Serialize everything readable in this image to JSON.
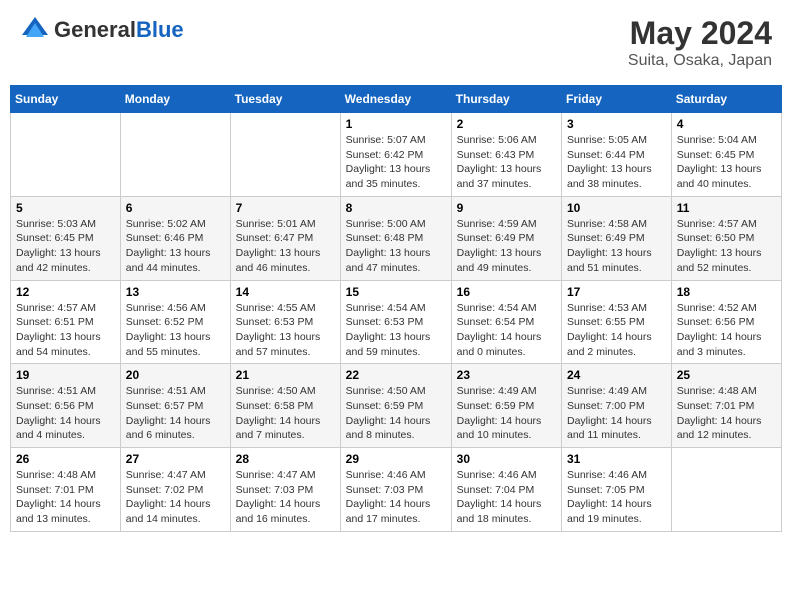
{
  "header": {
    "logo_general": "General",
    "logo_blue": "Blue",
    "month": "May 2024",
    "location": "Suita, Osaka, Japan"
  },
  "days_of_week": [
    "Sunday",
    "Monday",
    "Tuesday",
    "Wednesday",
    "Thursday",
    "Friday",
    "Saturday"
  ],
  "weeks": [
    [
      {
        "day": "",
        "info": ""
      },
      {
        "day": "",
        "info": ""
      },
      {
        "day": "",
        "info": ""
      },
      {
        "day": "1",
        "info": "Sunrise: 5:07 AM\nSunset: 6:42 PM\nDaylight: 13 hours\nand 35 minutes."
      },
      {
        "day": "2",
        "info": "Sunrise: 5:06 AM\nSunset: 6:43 PM\nDaylight: 13 hours\nand 37 minutes."
      },
      {
        "day": "3",
        "info": "Sunrise: 5:05 AM\nSunset: 6:44 PM\nDaylight: 13 hours\nand 38 minutes."
      },
      {
        "day": "4",
        "info": "Sunrise: 5:04 AM\nSunset: 6:45 PM\nDaylight: 13 hours\nand 40 minutes."
      }
    ],
    [
      {
        "day": "5",
        "info": "Sunrise: 5:03 AM\nSunset: 6:45 PM\nDaylight: 13 hours\nand 42 minutes."
      },
      {
        "day": "6",
        "info": "Sunrise: 5:02 AM\nSunset: 6:46 PM\nDaylight: 13 hours\nand 44 minutes."
      },
      {
        "day": "7",
        "info": "Sunrise: 5:01 AM\nSunset: 6:47 PM\nDaylight: 13 hours\nand 46 minutes."
      },
      {
        "day": "8",
        "info": "Sunrise: 5:00 AM\nSunset: 6:48 PM\nDaylight: 13 hours\nand 47 minutes."
      },
      {
        "day": "9",
        "info": "Sunrise: 4:59 AM\nSunset: 6:49 PM\nDaylight: 13 hours\nand 49 minutes."
      },
      {
        "day": "10",
        "info": "Sunrise: 4:58 AM\nSunset: 6:49 PM\nDaylight: 13 hours\nand 51 minutes."
      },
      {
        "day": "11",
        "info": "Sunrise: 4:57 AM\nSunset: 6:50 PM\nDaylight: 13 hours\nand 52 minutes."
      }
    ],
    [
      {
        "day": "12",
        "info": "Sunrise: 4:57 AM\nSunset: 6:51 PM\nDaylight: 13 hours\nand 54 minutes."
      },
      {
        "day": "13",
        "info": "Sunrise: 4:56 AM\nSunset: 6:52 PM\nDaylight: 13 hours\nand 55 minutes."
      },
      {
        "day": "14",
        "info": "Sunrise: 4:55 AM\nSunset: 6:53 PM\nDaylight: 13 hours\nand 57 minutes."
      },
      {
        "day": "15",
        "info": "Sunrise: 4:54 AM\nSunset: 6:53 PM\nDaylight: 13 hours\nand 59 minutes."
      },
      {
        "day": "16",
        "info": "Sunrise: 4:54 AM\nSunset: 6:54 PM\nDaylight: 14 hours\nand 0 minutes."
      },
      {
        "day": "17",
        "info": "Sunrise: 4:53 AM\nSunset: 6:55 PM\nDaylight: 14 hours\nand 2 minutes."
      },
      {
        "day": "18",
        "info": "Sunrise: 4:52 AM\nSunset: 6:56 PM\nDaylight: 14 hours\nand 3 minutes."
      }
    ],
    [
      {
        "day": "19",
        "info": "Sunrise: 4:51 AM\nSunset: 6:56 PM\nDaylight: 14 hours\nand 4 minutes."
      },
      {
        "day": "20",
        "info": "Sunrise: 4:51 AM\nSunset: 6:57 PM\nDaylight: 14 hours\nand 6 minutes."
      },
      {
        "day": "21",
        "info": "Sunrise: 4:50 AM\nSunset: 6:58 PM\nDaylight: 14 hours\nand 7 minutes."
      },
      {
        "day": "22",
        "info": "Sunrise: 4:50 AM\nSunset: 6:59 PM\nDaylight: 14 hours\nand 8 minutes."
      },
      {
        "day": "23",
        "info": "Sunrise: 4:49 AM\nSunset: 6:59 PM\nDaylight: 14 hours\nand 10 minutes."
      },
      {
        "day": "24",
        "info": "Sunrise: 4:49 AM\nSunset: 7:00 PM\nDaylight: 14 hours\nand 11 minutes."
      },
      {
        "day": "25",
        "info": "Sunrise: 4:48 AM\nSunset: 7:01 PM\nDaylight: 14 hours\nand 12 minutes."
      }
    ],
    [
      {
        "day": "26",
        "info": "Sunrise: 4:48 AM\nSunset: 7:01 PM\nDaylight: 14 hours\nand 13 minutes."
      },
      {
        "day": "27",
        "info": "Sunrise: 4:47 AM\nSunset: 7:02 PM\nDaylight: 14 hours\nand 14 minutes."
      },
      {
        "day": "28",
        "info": "Sunrise: 4:47 AM\nSunset: 7:03 PM\nDaylight: 14 hours\nand 16 minutes."
      },
      {
        "day": "29",
        "info": "Sunrise: 4:46 AM\nSunset: 7:03 PM\nDaylight: 14 hours\nand 17 minutes."
      },
      {
        "day": "30",
        "info": "Sunrise: 4:46 AM\nSunset: 7:04 PM\nDaylight: 14 hours\nand 18 minutes."
      },
      {
        "day": "31",
        "info": "Sunrise: 4:46 AM\nSunset: 7:05 PM\nDaylight: 14 hours\nand 19 minutes."
      },
      {
        "day": "",
        "info": ""
      }
    ]
  ]
}
